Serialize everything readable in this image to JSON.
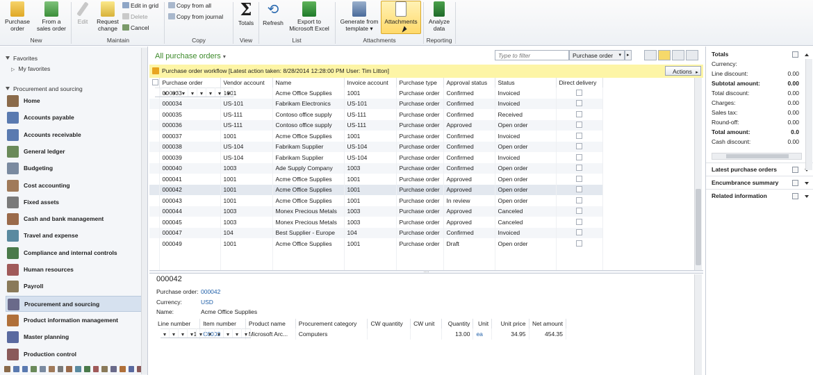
{
  "ribbon": {
    "new_group": "New",
    "purchase_order": "Purchase\norder",
    "from_sales_order": "From a\nsales order",
    "maintain_group": "Maintain",
    "edit": "Edit",
    "request_change": "Request\nchange",
    "edit_in_grid": "Edit in grid",
    "delete": "Delete",
    "cancel": "Cancel",
    "copy_group": "Copy",
    "copy_from_all": "Copy from all",
    "copy_from_journal": "Copy from journal",
    "view_group": "View",
    "totals": "Totals",
    "list_group": "List",
    "refresh": "Refresh",
    "export_excel": "Export to\nMicrosoft Excel",
    "attachments_group": "Attachments",
    "generate_from_template": "Generate from\ntemplate ▾",
    "attachments": "Attachments",
    "reporting_group": "Reporting",
    "analyze_data": "Analyze\ndata"
  },
  "nav": {
    "favorites": "Favorites",
    "my_favorites": "My favorites",
    "section": "Procurement and sourcing",
    "items": [
      {
        "label": "Home",
        "color": "#8a6a4a"
      },
      {
        "label": "Accounts payable",
        "color": "#5a7ab0"
      },
      {
        "label": "Accounts receivable",
        "color": "#5a7ab0"
      },
      {
        "label": "General ledger",
        "color": "#6a8a5a"
      },
      {
        "label": "Budgeting",
        "color": "#7a8aa0"
      },
      {
        "label": "Cost accounting",
        "color": "#a07a5a"
      },
      {
        "label": "Fixed assets",
        "color": "#7a7a7a"
      },
      {
        "label": "Cash and bank management",
        "color": "#9a6a4a"
      },
      {
        "label": "Travel and expense",
        "color": "#5a8aa0"
      },
      {
        "label": "Compliance and internal controls",
        "color": "#4a7a4a"
      },
      {
        "label": "Human resources",
        "color": "#a05a5a"
      },
      {
        "label": "Payroll",
        "color": "#8a7a5a"
      },
      {
        "label": "Procurement and sourcing",
        "color": "#6a6a8a"
      },
      {
        "label": "Product information management",
        "color": "#b0703a"
      },
      {
        "label": "Master planning",
        "color": "#5a6aa0"
      },
      {
        "label": "Production control",
        "color": "#8a5a5a"
      }
    ]
  },
  "list": {
    "title": "All purchase orders",
    "filter_placeholder": "Type to filter",
    "filter_field": "Purchase order",
    "workflow_text": "Purchase order workflow  [Latest action taken: 8/28/2014 12:28:00 PM  User: Tim Litton]",
    "actions": "Actions",
    "columns": [
      "Purchase order",
      "Vendor account",
      "Name",
      "Invoice account",
      "Purchase type",
      "Approval status",
      "Status",
      "Direct delivery"
    ],
    "rows": [
      [
        "000033",
        "1001",
        "Acme Office Supplies",
        "1001",
        "Purchase order",
        "Confirmed",
        "Invoiced"
      ],
      [
        "000034",
        "US-101",
        "Fabrikam Electronics",
        "US-101",
        "Purchase order",
        "Confirmed",
        "Invoiced"
      ],
      [
        "000035",
        "US-111",
        "Contoso office supply",
        "US-111",
        "Purchase order",
        "Confirmed",
        "Received"
      ],
      [
        "000036",
        "US-111",
        "Contoso office supply",
        "US-111",
        "Purchase order",
        "Approved",
        "Open order"
      ],
      [
        "000037",
        "1001",
        "Acme Office Supplies",
        "1001",
        "Purchase order",
        "Confirmed",
        "Invoiced"
      ],
      [
        "000038",
        "US-104",
        "Fabrikam Supplier",
        "US-104",
        "Purchase order",
        "Confirmed",
        "Open order"
      ],
      [
        "000039",
        "US-104",
        "Fabrikam Supplier",
        "US-104",
        "Purchase order",
        "Confirmed",
        "Invoiced"
      ],
      [
        "000040",
        "1003",
        "Ade Supply Company",
        "1003",
        "Purchase order",
        "Confirmed",
        "Open order"
      ],
      [
        "000041",
        "1001",
        "Acme Office Supplies",
        "1001",
        "Purchase order",
        "Approved",
        "Open order"
      ],
      [
        "000042",
        "1001",
        "Acme Office Supplies",
        "1001",
        "Purchase order",
        "Approved",
        "Open order"
      ],
      [
        "000043",
        "1001",
        "Acme Office Supplies",
        "1001",
        "Purchase order",
        "In review",
        "Open order"
      ],
      [
        "000044",
        "1003",
        "Monex Precious Metals",
        "1003",
        "Purchase order",
        "Approved",
        "Canceled"
      ],
      [
        "000045",
        "1003",
        "Monex Precious Metals",
        "1003",
        "Purchase order",
        "Approved",
        "Canceled"
      ],
      [
        "000047",
        "104",
        "Best Supplier - Europe",
        "104",
        "Purchase order",
        "Confirmed",
        "Invoiced"
      ],
      [
        "000049",
        "1001",
        "Acme Office Supplies",
        "1001",
        "Purchase order",
        "Draft",
        "Open order"
      ]
    ]
  },
  "detail": {
    "title": "000042",
    "purchase_order_label": "Purchase order:",
    "purchase_order": "000042",
    "currency_label": "Currency:",
    "currency": "USD",
    "name_label": "Name:",
    "name": "Acme Office Supplies",
    "columns": [
      "Line number",
      "Item number",
      "Product name",
      "Procurement category",
      "CW quantity",
      "CW unit",
      "Quantity",
      "Unit",
      "Unit price",
      "Net amount"
    ],
    "line": [
      "1",
      "C0003",
      "Microsoft Arc...",
      "Computers",
      "",
      "",
      "13.00",
      "ea",
      "34.95",
      "454.35"
    ]
  },
  "factbox": {
    "totals": "Totals",
    "rows": [
      {
        "label": "Currency:",
        "value": "",
        "bold": false
      },
      {
        "label": "Line discount:",
        "value": "0.00",
        "bold": false
      },
      {
        "label": "Subtotal amount:",
        "value": "0.00",
        "bold": true
      },
      {
        "label": "Total discount:",
        "value": "0.00",
        "bold": false
      },
      {
        "label": "Charges:",
        "value": "0.00",
        "bold": false
      },
      {
        "label": "Sales tax:",
        "value": "0.00",
        "bold": false
      },
      {
        "label": "Round-off:",
        "value": "0.00",
        "bold": false
      },
      {
        "label": "Total amount:",
        "value": "0.0",
        "bold": true
      },
      {
        "label": "Cash discount:",
        "value": "0.00",
        "bold": false
      }
    ],
    "sections": [
      "Latest purchase orders",
      "Encumbrance summary",
      "Related information"
    ]
  }
}
